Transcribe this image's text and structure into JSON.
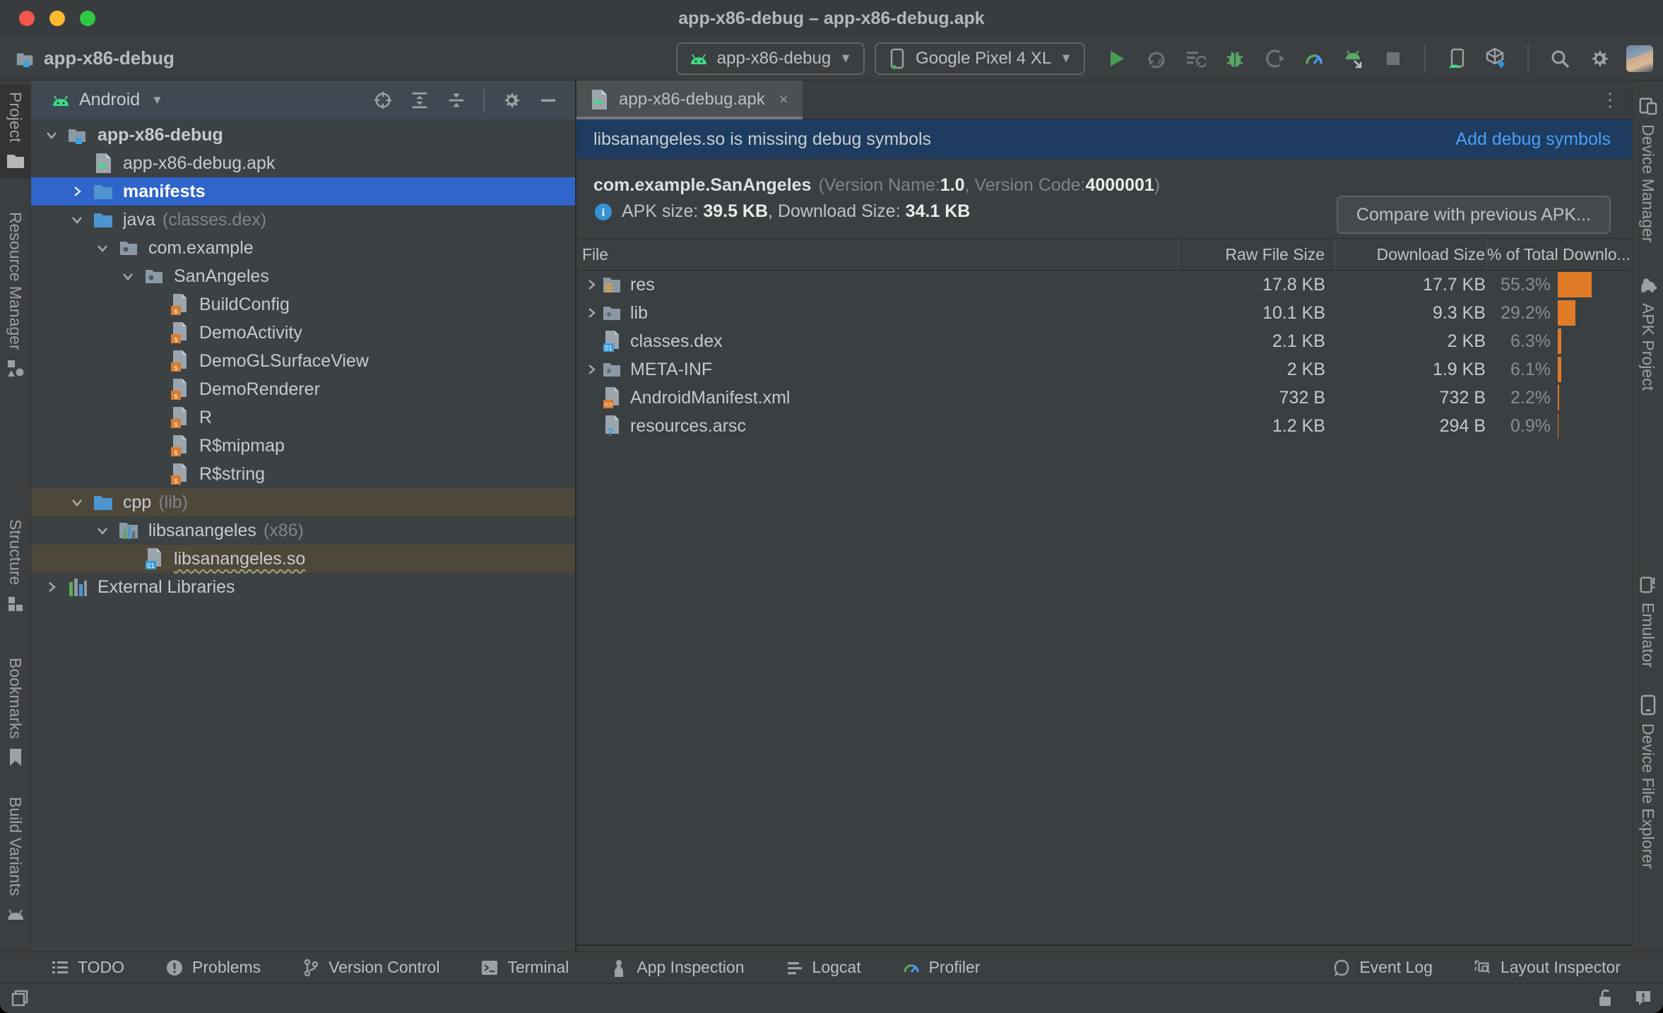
{
  "window": {
    "title": "app-x86-debug – app-x86-debug.apk"
  },
  "toolbar": {
    "project_name": "app-x86-debug",
    "run_config": {
      "label": "app-x86-debug",
      "icon": "android-head"
    },
    "device": {
      "label": "Google Pixel 4 XL",
      "icon": "phone-device"
    },
    "icons": [
      {
        "name": "run",
        "icon": "run"
      },
      {
        "name": "apply-changes",
        "icon": "apply-changes"
      },
      {
        "name": "apply-code-changes",
        "icon": "apply-code"
      },
      {
        "name": "debug",
        "icon": "debug"
      },
      {
        "name": "profile-app",
        "icon": "profile-attach"
      },
      {
        "name": "profiler",
        "icon": "profiler"
      },
      {
        "name": "attach-debugger",
        "icon": "attach-android"
      },
      {
        "name": "stop",
        "icon": "stop"
      }
    ]
  },
  "left_stripe": [
    {
      "label": "Project",
      "icon": "project-folder",
      "active": true
    },
    {
      "label": "Resource Manager",
      "icon": "resource-manager",
      "active": false
    },
    {
      "label": "Structure",
      "icon": "structure",
      "active": false
    },
    {
      "label": "Bookmarks",
      "icon": "bookmark",
      "active": false
    },
    {
      "label": "Build Variants",
      "icon": "android-gray",
      "active": false
    }
  ],
  "right_stripe": [
    {
      "label": "Device Manager",
      "icon": "device-manager"
    },
    {
      "label": "APK Project",
      "icon": "apk-project"
    },
    {
      "label": "Emulator",
      "icon": "emulator"
    },
    {
      "label": "Device File Explorer",
      "icon": "device-file-explorer"
    }
  ],
  "project_panel": {
    "view_selector": "Android",
    "tree": [
      {
        "label": "app-x86-debug",
        "level": 0,
        "chevron": "down",
        "icon": "folder-module",
        "bold": true
      },
      {
        "label": "app-x86-debug.apk",
        "level": 1,
        "chevron": null,
        "icon": "file-apk"
      },
      {
        "label": "manifests",
        "level": 1,
        "chevron": "right",
        "icon": "folder-blue",
        "highlight": "blue",
        "bold": true
      },
      {
        "label": "java",
        "meta": "(classes.dex)",
        "level": 1,
        "chevron": "down",
        "icon": "folder-blue"
      },
      {
        "label": "com.example",
        "level": 2,
        "chevron": "down",
        "icon": "package-folder"
      },
      {
        "label": "SanAngeles",
        "level": 3,
        "chevron": "down",
        "icon": "package-folder"
      },
      {
        "label": "BuildConfig",
        "level": 4,
        "chevron": null,
        "icon": "file-class"
      },
      {
        "label": "DemoActivity",
        "level": 4,
        "chevron": null,
        "icon": "file-class"
      },
      {
        "label": "DemoGLSurfaceView",
        "level": 4,
        "chevron": null,
        "icon": "file-class"
      },
      {
        "label": "DemoRenderer",
        "level": 4,
        "chevron": null,
        "icon": "file-class"
      },
      {
        "label": "R",
        "level": 4,
        "chevron": null,
        "icon": "file-class"
      },
      {
        "label": "R$mipmap",
        "level": 4,
        "chevron": null,
        "icon": "file-class"
      },
      {
        "label": "R$string",
        "level": 4,
        "chevron": null,
        "icon": "file-class"
      },
      {
        "label": "cpp",
        "meta": "(lib)",
        "level": 1,
        "chevron": "down",
        "icon": "folder-blue",
        "highlight": "olive"
      },
      {
        "label": "libsanangeles",
        "meta": "(x86)",
        "level": 2,
        "chevron": "down",
        "icon": "lib-module"
      },
      {
        "label": "libsanangeles.so",
        "level": 3,
        "chevron": null,
        "icon": "file-binary",
        "highlight": "olive",
        "wavy": true
      },
      {
        "label": "External Libraries",
        "level": 0,
        "chevron": "right",
        "icon": "ext-lib"
      }
    ]
  },
  "editor": {
    "tab": {
      "label": "app-x86-debug.apk",
      "icon": "file-apk",
      "close": "×"
    },
    "kebab": "⋮",
    "banner": {
      "message": "libsanangeles.so is missing debug symbols",
      "action": "Add debug symbols"
    },
    "apk_info": {
      "app_id": "com.example.SanAngeles",
      "version_name_prefix": "(Version Name: ",
      "version_name": "1.0",
      "version_code_prefix": ", Version Code: ",
      "version_code": "4000001",
      "version_suffix": ")",
      "size_prefix": "APK size: ",
      "apk_size": "39.5 KB",
      "download_prefix": ", Download Size: ",
      "download_size": "34.1 KB",
      "compare_button": "Compare with previous APK..."
    },
    "table": {
      "columns": [
        "File",
        "Raw File Size",
        "Download Size",
        "% of Total Downlo..."
      ],
      "bar_color": "#e07b28",
      "rows": [
        {
          "name": "res",
          "icon": "folder-res",
          "expandable": true,
          "raw": "17.8 KB",
          "download": "17.7 KB",
          "percent": "55.3%"
        },
        {
          "name": "lib",
          "icon": "folder-dim",
          "expandable": true,
          "raw": "10.1 KB",
          "download": "9.3 KB",
          "percent": "29.2%"
        },
        {
          "name": "classes.dex",
          "icon": "file-binary",
          "expandable": false,
          "raw": "2.1 KB",
          "download": "2 KB",
          "percent": "6.3%"
        },
        {
          "name": "META-INF",
          "icon": "folder-dim",
          "expandable": true,
          "raw": "2 KB",
          "download": "1.9 KB",
          "percent": "6.1%"
        },
        {
          "name": "AndroidManifest.xml",
          "icon": "file-manifest",
          "expandable": false,
          "raw": "732 B",
          "download": "732 B",
          "percent": "2.2%"
        },
        {
          "name": "resources.arsc",
          "icon": "file-arsc",
          "expandable": false,
          "raw": "1.2 KB",
          "download": "294 B",
          "percent": "0.9%"
        }
      ]
    }
  },
  "bottom_bar": {
    "left": [
      {
        "label": "TODO",
        "icon": "todo"
      },
      {
        "label": "Problems",
        "icon": "problems"
      },
      {
        "label": "Version Control",
        "icon": "vcs"
      },
      {
        "label": "Terminal",
        "icon": "terminal"
      },
      {
        "label": "App Inspection",
        "icon": "app-inspection"
      },
      {
        "label": "Logcat",
        "icon": "logcat"
      },
      {
        "label": "Profiler",
        "icon": "profiler-small"
      }
    ],
    "right": [
      {
        "label": "Event Log",
        "icon": "event-log"
      },
      {
        "label": "Layout Inspector",
        "icon": "layout-inspector"
      }
    ]
  },
  "status_bar": {
    "icons_left": [
      "windows"
    ],
    "icons_right": [
      "lock-open",
      "notify"
    ]
  }
}
